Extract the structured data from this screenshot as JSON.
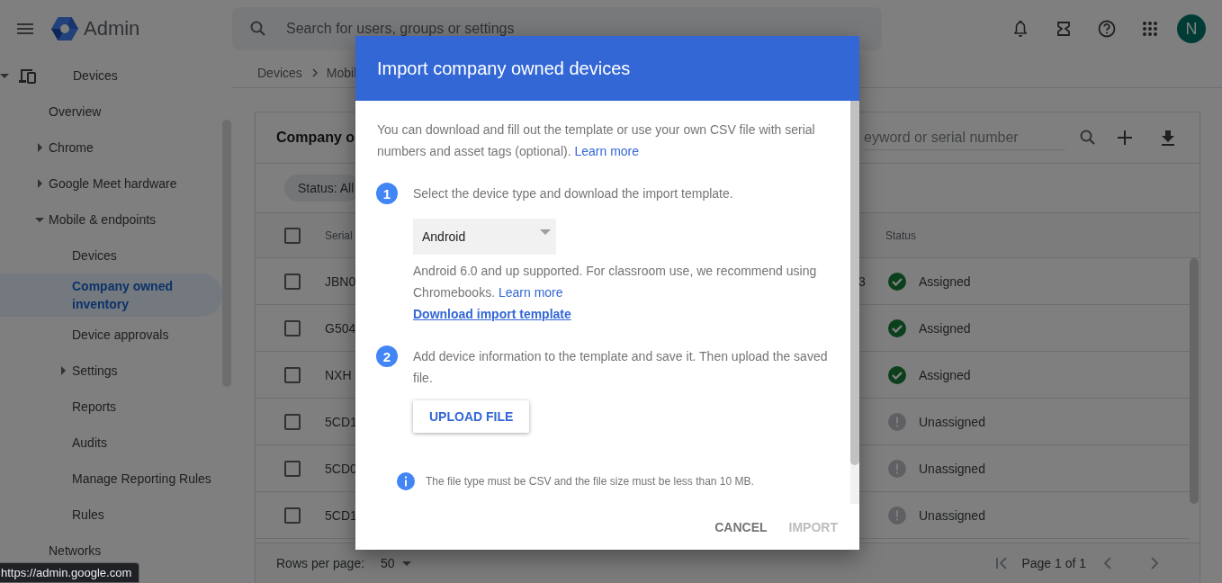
{
  "topbar": {
    "app_name": "Admin",
    "search": {
      "placeholder": "Search for users, groups or settings"
    },
    "avatar": "N"
  },
  "sidebar": {
    "items": [
      {
        "label": "Devices",
        "expanded": true,
        "selected": false,
        "children": [
          {
            "label": "Overview",
            "selected": false
          },
          {
            "label": "Chrome",
            "expanded": false,
            "selected": false
          },
          {
            "label": "Google Meet hardware",
            "expanded": false,
            "selected": false
          },
          {
            "label": "Mobile & endpoints",
            "expanded": true,
            "selected": false,
            "children": [
              {
                "label": "Devices",
                "selected": false
              },
              {
                "label": "Company owned inventory",
                "selected": true
              },
              {
                "label": "Device approvals",
                "selected": false
              },
              {
                "label": "Settings",
                "expanded": false,
                "selected": false
              },
              {
                "label": "Reports",
                "selected": false
              },
              {
                "label": "Audits",
                "selected": false
              },
              {
                "label": "Manage Reporting Rules",
                "selected": false
              },
              {
                "label": "Rules",
                "selected": false
              }
            ]
          },
          {
            "label": "Networks",
            "selected": false
          }
        ]
      }
    ]
  },
  "breadcrumb": [
    "Devices",
    "Mobil"
  ],
  "card": {
    "title": "Company o",
    "search": {
      "placeholder": "eyword or serial number"
    },
    "filter_chip": "Status: All",
    "table": {
      "select_all_checked": false,
      "columns": {
        "serial": "Serial",
        "status": "Status"
      },
      "rows": [
        {
          "checked": false,
          "serial": "JBN0",
          "column_2": "3",
          "status": "Assigned",
          "kind": "assigned"
        },
        {
          "checked": false,
          "serial": "G504",
          "status": "Assigned",
          "kind": "assigned"
        },
        {
          "checked": false,
          "serial": "NXH",
          "status": "Assigned",
          "kind": "assigned"
        },
        {
          "checked": false,
          "serial": "5CD1",
          "status": "Unassigned",
          "kind": "unassigned"
        },
        {
          "checked": false,
          "serial": "5CD0",
          "status": "Unassigned",
          "kind": "unassigned"
        },
        {
          "checked": false,
          "serial": "5CD1",
          "status": "Unassigned",
          "kind": "unassigned"
        }
      ]
    },
    "footer": {
      "rows_per_page_label": "Rows per page:",
      "rows_per_page": "50",
      "page": "Page 1 of 1"
    }
  },
  "dialog": {
    "title": "Import company owned devices",
    "intro": "You can download and fill out the template or use your own CSV file with serial numbers and asset tags (optional).",
    "intro_link": "Learn more",
    "steps": [
      {
        "number": "1",
        "text": "Select the device type and download the import template.",
        "device_type": "Android",
        "note": "Android 6.0 and up supported. For classroom use, we recommend using Chromebooks.",
        "note_link": "Learn more",
        "download_link": "Download import template"
      },
      {
        "number": "2",
        "text": "Add device information to the template and save it. Then upload the saved file.",
        "button": "UPLOAD FILE"
      }
    ],
    "info": "The file type must be CSV and the file size must be less than 10 MB.",
    "actions": [
      {
        "label": "CANCEL",
        "disabled": false
      },
      {
        "label": "IMPORT",
        "disabled": true
      }
    ]
  },
  "status_url": "https://admin.google.com"
}
